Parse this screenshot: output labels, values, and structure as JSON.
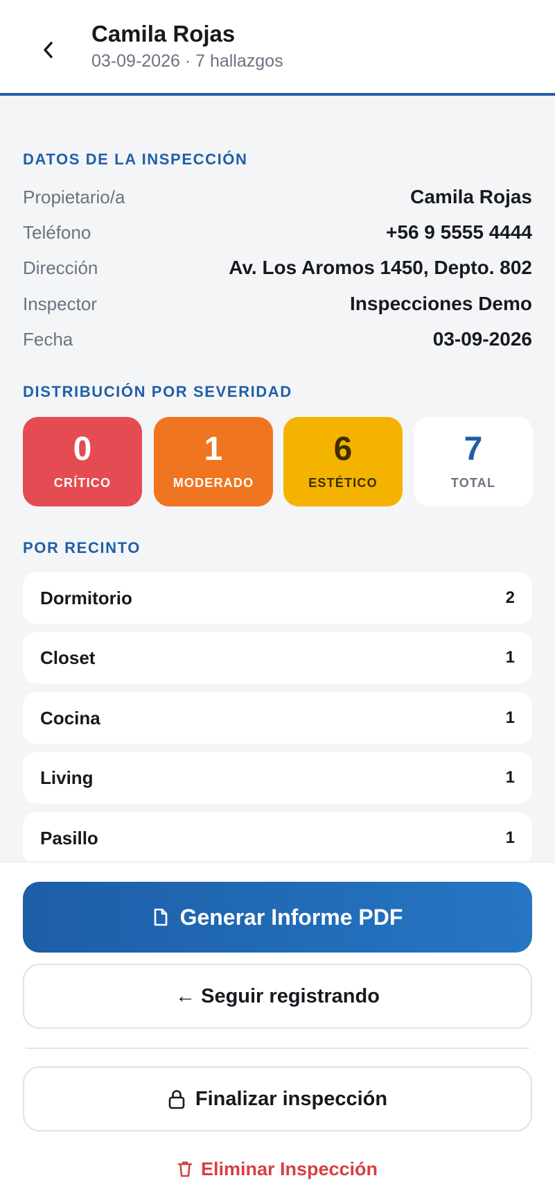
{
  "header": {
    "title": "Camila Rojas",
    "subtitle": "03-09-2026 · 7 hallazgos"
  },
  "details": {
    "section_label": "DATOS DE LA INSPECCIÓN",
    "rows": [
      {
        "label": "Propietario/a",
        "value": "Camila Rojas"
      },
      {
        "label": "Teléfono",
        "value": "+56 9 5555 4444"
      },
      {
        "label": "Dirección",
        "value": "Av. Los Aromos 1450, Depto. 802"
      },
      {
        "label": "Inspector",
        "value": "Inspecciones Demo"
      },
      {
        "label": "Fecha",
        "value": "03-09-2026"
      }
    ]
  },
  "severity": {
    "section_label": "DISTRIBUCIÓN POR SEVERIDAD",
    "cards": [
      {
        "count": "0",
        "label": "CRÍTICO",
        "bg": "#e54b52",
        "fg": "#ffffff"
      },
      {
        "count": "1",
        "label": "MODERADO",
        "bg": "#f07520",
        "fg": "#ffffff"
      },
      {
        "count": "6",
        "label": "ESTÉTICO",
        "bg": "#f3b300",
        "fg": "#3d2d00"
      },
      {
        "count": "7",
        "label": "TOTAL",
        "bg": "#ffffff",
        "fg": "#1f5fa8",
        "label_fg": "#6b7280"
      }
    ]
  },
  "rooms": {
    "section_label": "POR RECINTO",
    "items": [
      {
        "name": "Dormitorio",
        "count": "2"
      },
      {
        "name": "Closet",
        "count": "1"
      },
      {
        "name": "Cocina",
        "count": "1"
      },
      {
        "name": "Living",
        "count": "1"
      },
      {
        "name": "Pasillo",
        "count": "1"
      }
    ]
  },
  "actions": {
    "generate_pdf": "Generar Informe PDF",
    "continue": "← Seguir registrando",
    "finalize": "Finalizar inspección",
    "delete": "Eliminar Inspección"
  },
  "colors": {
    "accent": "#1f5fa8",
    "danger": "#d64040"
  },
  "icons": {
    "back": "chevron-left-icon",
    "pdf": "document-icon",
    "finalize": "lock-icon",
    "delete": "trash-icon"
  }
}
